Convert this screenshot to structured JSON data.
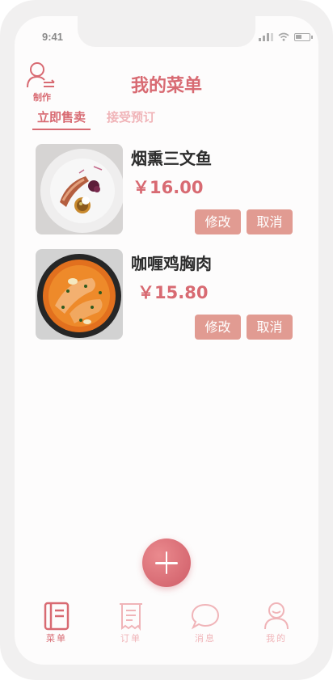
{
  "status_bar": {
    "time": "9:41"
  },
  "header": {
    "title": "我的菜单",
    "make_label": "制作"
  },
  "tabs": [
    {
      "label": "立即售卖",
      "active": true
    },
    {
      "label": "接受预订",
      "active": false
    }
  ],
  "dishes": [
    {
      "name": "烟熏三文鱼",
      "price": "￥16.00",
      "edit_label": "修改",
      "cancel_label": "取消",
      "image": "smoked-salmon-plate"
    },
    {
      "name": "咖喱鸡胸肉",
      "price": "￥15.80",
      "edit_label": "修改",
      "cancel_label": "取消",
      "image": "curry-chicken-pan"
    }
  ],
  "add_button": {
    "icon": "plus-icon"
  },
  "tabbar": [
    {
      "label": "菜单",
      "icon": "menu-book-icon",
      "active": true
    },
    {
      "label": "订单",
      "icon": "receipt-icon",
      "active": false
    },
    {
      "label": "消息",
      "icon": "chat-bubble-icon",
      "active": false
    },
    {
      "label": "我的",
      "icon": "profile-icon",
      "active": false
    }
  ],
  "colors": {
    "accent": "#d86a72",
    "accent_light": "#f0b4b8",
    "button": "#e19b92",
    "text_dark": "#2c2c2c"
  }
}
